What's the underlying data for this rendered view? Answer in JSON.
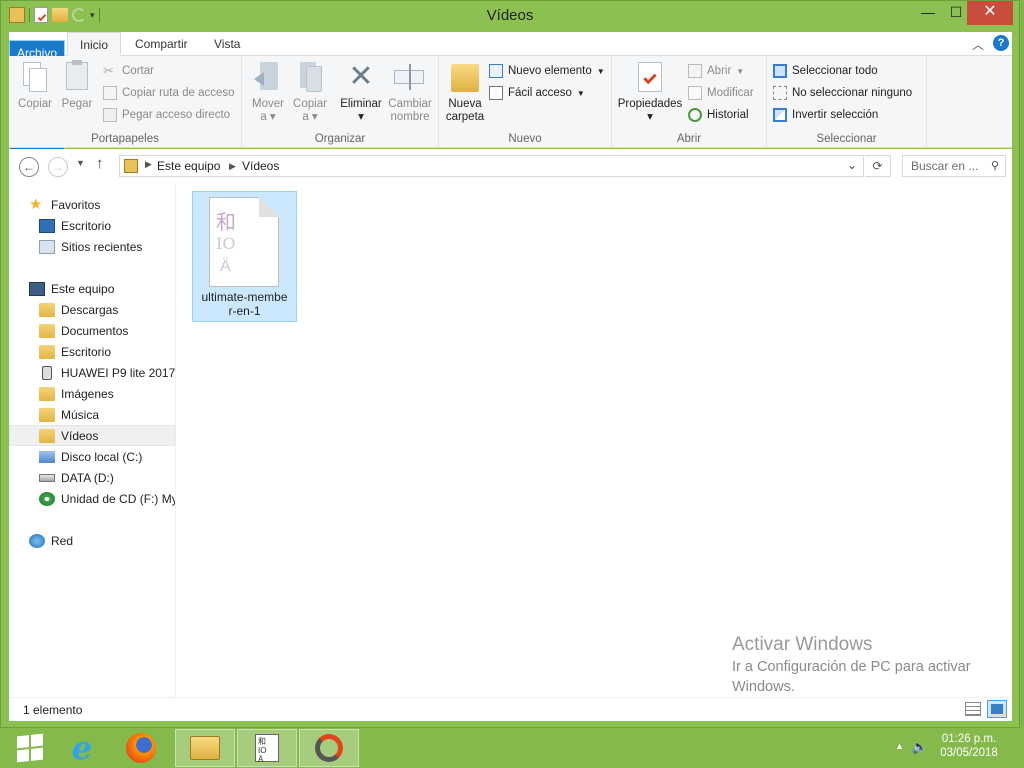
{
  "window": {
    "title": "Vídeos",
    "minimize_glyph": "—",
    "maximize_glyph": "☐",
    "close_glyph": "✕"
  },
  "ribbon_tabs": [
    {
      "label": "Archivo"
    },
    {
      "label": "Inicio"
    },
    {
      "label": "Compartir"
    },
    {
      "label": "Vista"
    }
  ],
  "ribbon": {
    "groups": {
      "portapapeles": "Portapapeles",
      "organizar": "Organizar",
      "nuevo": "Nuevo",
      "abrir": "Abrir",
      "seleccionar": "Seleccionar"
    },
    "copiar": "Copiar",
    "pegar": "Pegar",
    "cortar": "Cortar",
    "copiar_ruta": "Copiar ruta de acceso",
    "pegar_acceso": "Pegar acceso directo",
    "mover_a": "Mover",
    "mover_a2": "a",
    "copiar_a": "Copiar",
    "copiar_a2": "a",
    "eliminar": "Eliminar",
    "cambiar": "Cambiar",
    "cambiar2": "nombre",
    "nueva": "Nueva",
    "nueva2": "carpeta",
    "nuevo_elemento": "Nuevo elemento",
    "facil_acceso": "Fácil acceso",
    "propiedades": "Propiedades",
    "abrir": "Abrir",
    "modificar": "Modificar",
    "historial": "Historial",
    "seleccionar_todo": "Seleccionar todo",
    "no_seleccionar": "No seleccionar ninguno",
    "invertir": "Invertir selección"
  },
  "address": {
    "crumbs": [
      "Este equipo",
      "Vídeos"
    ],
    "search_placeholder": "Buscar en ..."
  },
  "nav": {
    "favoritos": "Favoritos",
    "escritorio": "Escritorio",
    "sitios": "Sitios recientes",
    "este_equipo": "Este equipo",
    "descargas": "Descargas",
    "documentos": "Documentos",
    "escritorio2": "Escritorio",
    "huawei": "HUAWEI P9 lite 2017",
    "imagenes": "Imágenes",
    "musica": "Música",
    "videos": "Vídeos",
    "disco_c": "Disco local (C:)",
    "data_d": "DATA (D:)",
    "cd_f": "Unidad de CD (F:) My",
    "red": "Red"
  },
  "files": [
    {
      "name": "ultimate-member-en-1",
      "name_line1": "ultimate-membe",
      "name_line2": "r-en-1"
    }
  ],
  "watermark": {
    "line1": "Activar Windows",
    "line2": "Ir a Configuración de PC para activar",
    "line3": "Windows."
  },
  "status": {
    "count": "1 elemento"
  },
  "tray": {
    "time": "01:26 p.m.",
    "date": "03/05/2018"
  }
}
